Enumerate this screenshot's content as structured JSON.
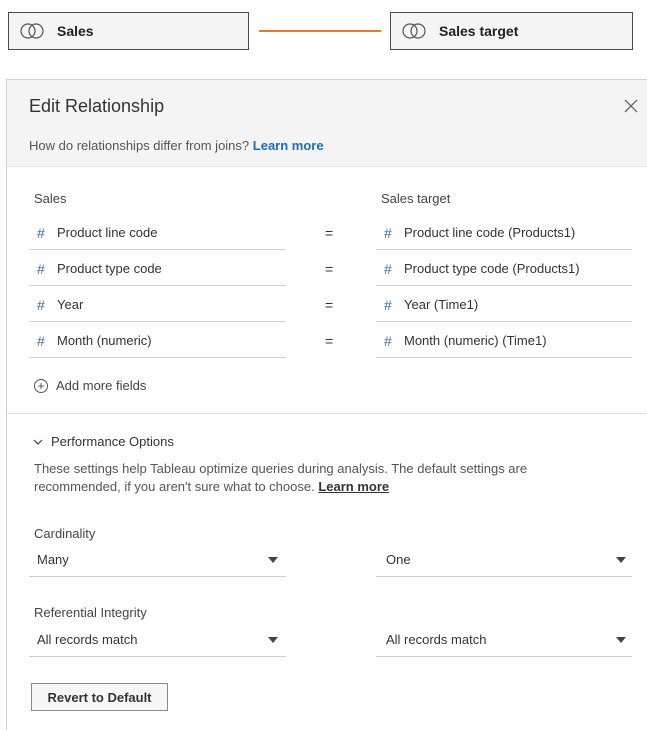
{
  "top": {
    "left_table": "Sales",
    "right_table": "Sales target",
    "colors": {
      "relationship_line": "#e8762b"
    }
  },
  "dialog": {
    "title": "Edit Relationship",
    "close_icon": "close-icon",
    "help_text": "How do relationships differ from joins?",
    "help_link": "Learn more",
    "left_header": "Sales",
    "right_header": "Sales target",
    "operator": "=",
    "field_pairs": [
      {
        "left": "Product line code",
        "right": "Product line code (Products1)"
      },
      {
        "left": "Product type code",
        "right": "Product type code (Products1)"
      },
      {
        "left": "Year",
        "right": "Year (Time1)"
      },
      {
        "left": "Month (numeric)",
        "right": "Month (numeric) (Time1)"
      }
    ],
    "field_icon": "#",
    "add_fields_label": "Add more fields",
    "performance": {
      "title": "Performance Options",
      "description": "These settings help Tableau optimize queries during analysis. The default settings are recommended, if you aren't sure what to choose.",
      "learn_more": "Learn more",
      "cardinality_label": "Cardinality",
      "cardinality_left": "Many",
      "cardinality_right": "One",
      "integrity_label": "Referential Integrity",
      "integrity_left": "All records match",
      "integrity_right": "All records match",
      "revert_label": "Revert to Default"
    },
    "colors": {
      "link": "#1f6db5",
      "field_icon": "#3f6ea5",
      "header_bg": "#f4f4f4"
    }
  }
}
